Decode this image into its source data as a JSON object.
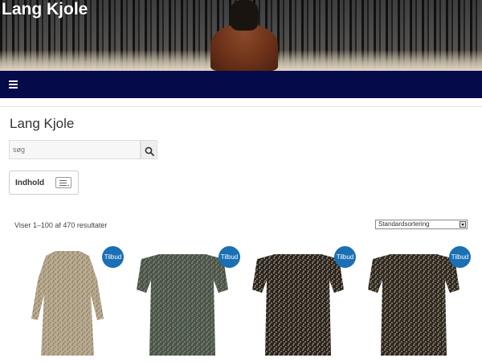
{
  "site": {
    "title": "Lang Kjole"
  },
  "nav": {
    "menu_icon": "hamburger-menu-icon"
  },
  "page": {
    "title": "Lang Kjole"
  },
  "search": {
    "placeholder": "søg",
    "button_icon": "search-icon"
  },
  "toc": {
    "label": "Indhold",
    "toggle_icon": "list-toggle-icon"
  },
  "results": {
    "count_text": "Viser 1–100 af 470 resultater"
  },
  "sort": {
    "selected": "Standardsortering"
  },
  "products": [
    {
      "badge": "Tilbud",
      "dress_color": "#b8ab90",
      "pattern_color": "#7a6a55",
      "style": "long-sleeve"
    },
    {
      "badge": "Tilbud",
      "dress_color": "#4a5548",
      "pattern_color": "#9aa092",
      "style": "off-shoulder"
    },
    {
      "badge": "Tilbud",
      "dress_color": "#2a2420",
      "pattern_color": "#d8c8a8",
      "style": "off-shoulder"
    },
    {
      "badge": "Tilbud",
      "dress_color": "#2e2822",
      "pattern_color": "#d0c0a0",
      "style": "off-shoulder"
    }
  ],
  "colors": {
    "navbar": "#050a4a",
    "badge": "#1a6fb5"
  }
}
